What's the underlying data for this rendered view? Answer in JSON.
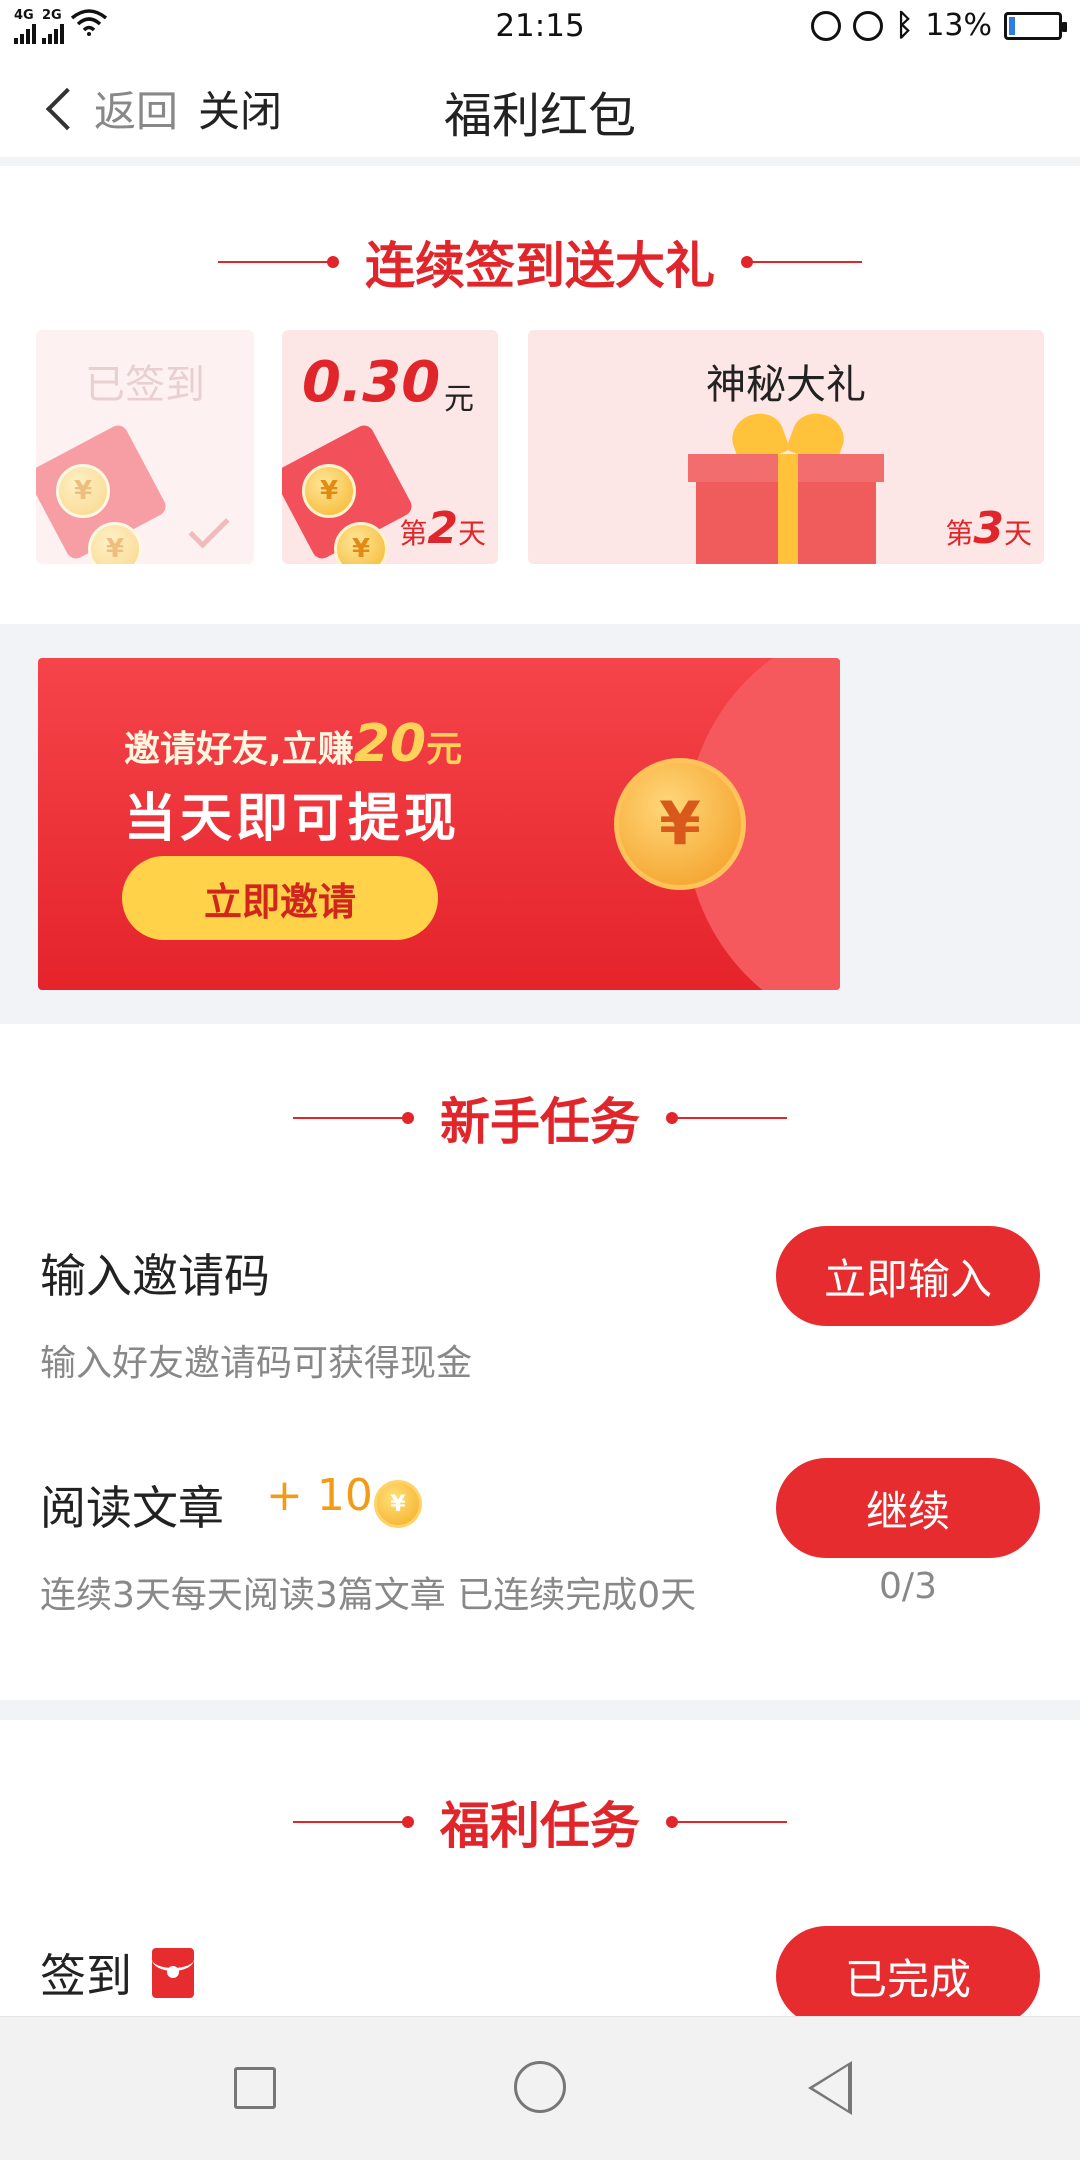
{
  "status_bar": {
    "network1": "4G",
    "network2": "2G",
    "time": "21:15",
    "battery": "13%",
    "battery_level": 0.13
  },
  "nav": {
    "back_label": "返回",
    "close_label": "关闭",
    "title": "福利红包"
  },
  "signin": {
    "header": "连续签到送大礼",
    "day1": {
      "label": "已签到"
    },
    "day2": {
      "amount": "0.30",
      "unit": "元",
      "day_prefix": "第",
      "day_num": "2",
      "day_suffix": "天"
    },
    "day3": {
      "label": "神秘大礼",
      "day_prefix": "第",
      "day_num": "3",
      "day_suffix": "天"
    },
    "coin_symbol": "¥"
  },
  "banner": {
    "line1_prefix": "邀请好友,立赚",
    "line1_amount": "20",
    "line1_unit": "元",
    "line2": "当天即可提现",
    "button": "立即邀请",
    "coin_symbol": "¥"
  },
  "newbie": {
    "header": "新手任务",
    "tasks": [
      {
        "title": "输入邀请码",
        "desc": "输入好友邀请码可获得现金",
        "button": "立即输入"
      },
      {
        "title": "阅读文章",
        "reward": "+ 10",
        "desc": "连续3天每天阅读3篇文章 已连续完成0天",
        "button": "继续",
        "progress": "0/3"
      }
    ]
  },
  "welfare": {
    "header": "福利任务",
    "tasks": [
      {
        "title": "签到",
        "button": "已完成"
      }
    ]
  },
  "colors": {
    "accent": "#e0262a",
    "button": "#e62c2f",
    "gold": "#ffd24a"
  }
}
